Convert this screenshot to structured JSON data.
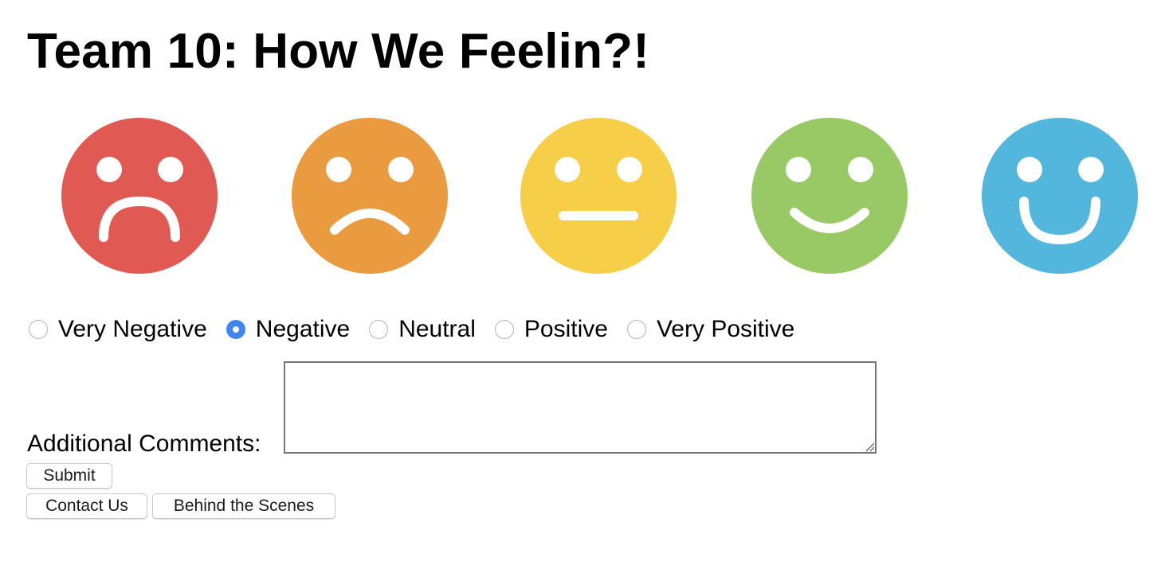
{
  "page": {
    "title": "Team 10: How We Feelin?!"
  },
  "faces": [
    {
      "icon": "very-sad-face-icon",
      "color": "#e05a53"
    },
    {
      "icon": "sad-face-icon",
      "color": "#ea9a3f"
    },
    {
      "icon": "neutral-face-icon",
      "color": "#f6ce47"
    },
    {
      "icon": "happy-face-icon",
      "color": "#98c965"
    },
    {
      "icon": "very-happy-face-icon",
      "color": "#53b6dc"
    }
  ],
  "mood_options": {
    "items": [
      {
        "label": "Very Negative",
        "checked": false
      },
      {
        "label": "Negative",
        "checked": true
      },
      {
        "label": "Neutral",
        "checked": false
      },
      {
        "label": "Positive",
        "checked": false
      },
      {
        "label": "Very Positive",
        "checked": false
      }
    ],
    "selected": "Negative",
    "accent_color": "#3d86f0"
  },
  "comments": {
    "label": "Additional Comments:",
    "value": ""
  },
  "buttons": {
    "submit": "Submit",
    "contact": "Contact Us",
    "behind": "Behind the Scenes"
  }
}
